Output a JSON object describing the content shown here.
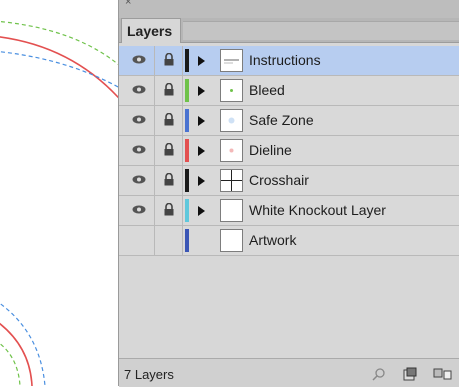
{
  "panel": {
    "tab_label": "Layers",
    "close_glyph": "×",
    "status": "7 Layers"
  },
  "layers": [
    {
      "name": "Instructions",
      "color": "#1a1a1a",
      "selected": true,
      "visible": true,
      "locked": true,
      "thumb": "instructions"
    },
    {
      "name": "Bleed",
      "color": "#6fc24a",
      "selected": false,
      "visible": true,
      "locked": true,
      "thumb": "bleed"
    },
    {
      "name": "Safe Zone",
      "color": "#4a73d1",
      "selected": false,
      "visible": true,
      "locked": true,
      "thumb": "safe"
    },
    {
      "name": "Dieline",
      "color": "#e35050",
      "selected": false,
      "visible": true,
      "locked": true,
      "thumb": "dieline"
    },
    {
      "name": "Crosshair",
      "color": "#1a1a1a",
      "selected": false,
      "visible": true,
      "locked": true,
      "thumb": "crosshair"
    },
    {
      "name": "White Knockout Layer",
      "color": "#5fc8dc",
      "selected": false,
      "visible": true,
      "locked": true,
      "thumb": "blank"
    },
    {
      "name": "Artwork",
      "color": "#3b56b5",
      "selected": false,
      "visible": false,
      "locked": false,
      "thumb": "blank"
    }
  ],
  "footer_icons": [
    "search-icon",
    "new-sublayer-icon",
    "new-layer-icon"
  ],
  "canvas": {
    "guide_colors": {
      "bleed": "#6fc24a",
      "dieline": "#e35050",
      "safe": "#4a8fe0"
    }
  }
}
